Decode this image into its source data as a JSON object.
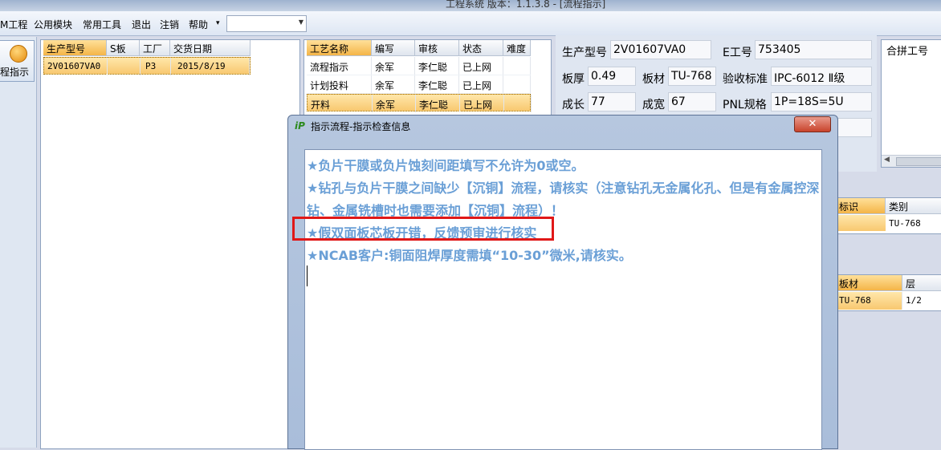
{
  "window": {
    "title": "工程系统    版本：1.1.3.8 - [流程指示]"
  },
  "menu": {
    "items": [
      "M工程",
      "公用模块",
      "常用工具",
      "退出",
      "注销",
      "帮助"
    ],
    "help_arrow": "▾",
    "combo_value": ""
  },
  "leftnav": {
    "label": "程指示"
  },
  "order_grid": {
    "columns": [
      "生产型号",
      "S板",
      "工厂",
      "交货日期"
    ],
    "rows": [
      {
        "model": "2V01607VA0",
        "s": "",
        "factory": "P3",
        "date": "2015/8/19"
      }
    ]
  },
  "process_grid": {
    "columns": [
      "工艺名称",
      "编写",
      "审核",
      "状态",
      "难度"
    ],
    "rows": [
      {
        "name": "流程指示",
        "writer": "余军",
        "reviewer": "李仁聪",
        "status": "已上网",
        "difficulty": ""
      },
      {
        "name": "计划投料",
        "writer": "余军",
        "reviewer": "李仁聪",
        "status": "已上网",
        "difficulty": ""
      },
      {
        "name": "开料",
        "writer": "余军",
        "reviewer": "李仁聪",
        "status": "已上网",
        "difficulty": ""
      }
    ]
  },
  "info": {
    "model_label": "生产型号",
    "model_value": "2V01607VA0",
    "eno_label": "E工号",
    "eno_value": "753405",
    "thickness_label": "板厚",
    "thickness_value": "0.49",
    "material_label": "板材",
    "material_value": "TU-768",
    "standard_label": "验收标准",
    "standard_value": "IPC-6012 Ⅱ级",
    "length_label": "成长",
    "length_value": "77",
    "width_label": "成宽",
    "width_value": "67",
    "pnl_label": "PNL规格",
    "pnl_value": "1P=18S=5U"
  },
  "merge_panel": {
    "header": "合拼工号"
  },
  "mark_grid": {
    "columns": [
      "标识",
      "类别"
    ],
    "rows": [
      {
        "mark": "",
        "type": "TU-768"
      }
    ]
  },
  "layer_grid": {
    "columns": [
      "板材",
      "层"
    ],
    "rows": [
      {
        "material": "TU-768",
        "layer": "1/2"
      }
    ]
  },
  "dialog": {
    "title": "指示流程-指示检查信息",
    "icon": "iP",
    "close": "✕",
    "messages": [
      "★负片干膜或负片蚀刻间距填写不允许为0或空。",
      "★钻孔与负片干膜之间缺少【沉铜】流程，请核实（注意钻孔无金属化孔、但是有金属控深",
      "钻、金属铣槽时也需要添加【沉铜】流程）！",
      "★假双面板芯板开错，反馈预审进行核实",
      "★NCAB客户:铜面阻焊厚度需填“10-30”微米,请核实。"
    ]
  },
  "colors": {
    "message": "#6a9fd6",
    "highlight": "#e01818",
    "row_selected": "#f8c870"
  }
}
